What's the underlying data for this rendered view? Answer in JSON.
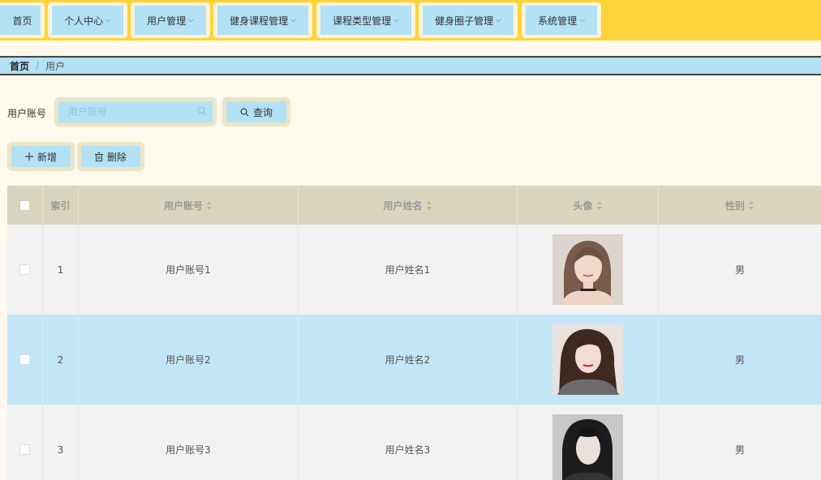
{
  "nav": {
    "items": [
      {
        "label": "首页",
        "dropdown": false
      },
      {
        "label": "个人中心",
        "dropdown": true
      },
      {
        "label": "用户管理",
        "dropdown": true
      },
      {
        "label": "健身课程管理",
        "dropdown": true
      },
      {
        "label": "课程类型管理",
        "dropdown": true
      },
      {
        "label": "健身圈子管理",
        "dropdown": true
      },
      {
        "label": "系统管理",
        "dropdown": true
      }
    ]
  },
  "breadcrumb": {
    "home": "首页",
    "separator": "/",
    "current": "用户"
  },
  "search": {
    "label": "用户账号",
    "placeholder": "用户账号",
    "value": "",
    "query_label": "查询"
  },
  "actions": {
    "add_label": "新增",
    "delete_label": "删除"
  },
  "table": {
    "columns": [
      "索引",
      "用户账号",
      "用户姓名",
      "头像",
      "性别"
    ],
    "rows": [
      {
        "index": "1",
        "account": "用户账号1",
        "name": "用户姓名1",
        "gender": "男"
      },
      {
        "index": "2",
        "account": "用户账号2",
        "name": "用户姓名2",
        "gender": "男"
      },
      {
        "index": "3",
        "account": "用户账号3",
        "name": "用户姓名3",
        "gender": "男"
      }
    ]
  },
  "colors": {
    "header_bg": "#fdd33a",
    "accent": "#b3e1f5",
    "page_bg": "#fdf9ec",
    "table_head": "#d9d4bd"
  }
}
